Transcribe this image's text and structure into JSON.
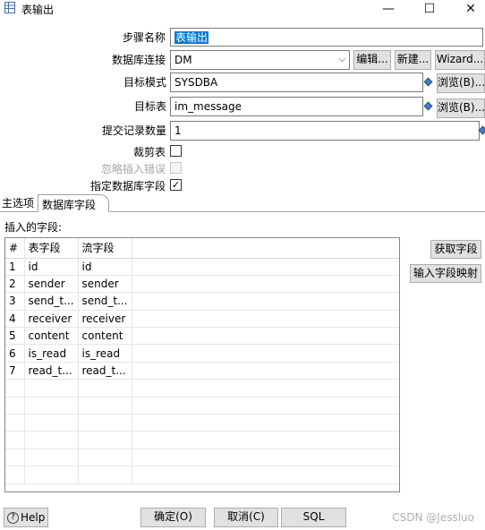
{
  "window": {
    "title": "表输出",
    "minimize": "—",
    "maximize": "☐",
    "close": "✕"
  },
  "form": {
    "step_name_label": "步骤名称",
    "step_name_value": "表输出",
    "connection_label": "数据库连接",
    "connection_value": "DM",
    "edit_button": "编辑...",
    "new_button": "新建...",
    "wizard_button": "Wizard...",
    "schema_label": "目标模式",
    "schema_value": "SYSDBA",
    "schema_browse": "浏览(B)...",
    "table_label": "目标表",
    "table_value": "im_message",
    "table_browse": "浏览(B)...",
    "commit_label": "提交记录数量",
    "commit_value": "1",
    "truncate_label": "裁剪表",
    "truncate_checked": false,
    "ignore_errors_label": "忽略插入错误",
    "ignore_errors_checked": false,
    "specify_fields_label": "指定数据库字段",
    "specify_fields_checked": true,
    "check_mark": "✓"
  },
  "tabs": {
    "main": "主选项",
    "db_fields": "数据库字段"
  },
  "fields": {
    "label": "插入的字段:",
    "headers": [
      "#",
      "表字段",
      "流字段"
    ],
    "rows": [
      [
        "1",
        "id",
        "id"
      ],
      [
        "2",
        "sender",
        "sender"
      ],
      [
        "3",
        "send_t...",
        "send_t..."
      ],
      [
        "4",
        "receiver",
        "receiver"
      ],
      [
        "5",
        "content",
        "content"
      ],
      [
        "6",
        "is_read",
        "is_read"
      ],
      [
        "7",
        "read_t...",
        "read_t..."
      ]
    ],
    "get_fields_button": "获取字段",
    "mapping_button": "输入字段映射"
  },
  "footer": {
    "help": "Help",
    "ok": "确定(O)",
    "cancel": "取消(C)",
    "sql": "SQL",
    "watermark": "CSDN @Jessluo"
  },
  "colors": {
    "selection": "#0078d7",
    "button_face": "#e1e1e1",
    "variable_icon": "#4c7cc2"
  }
}
